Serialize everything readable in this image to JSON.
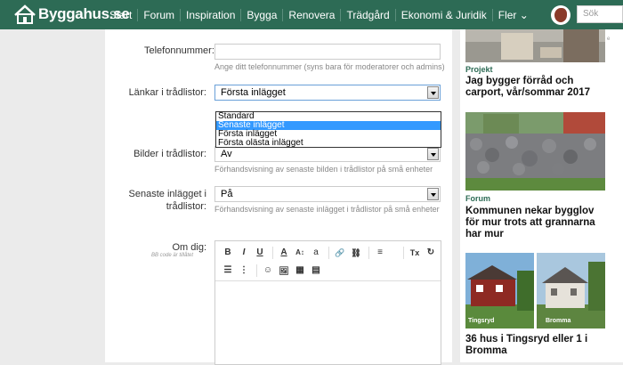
{
  "header": {
    "logo_text": "Byggahus.se",
    "nav": [
      "Start",
      "Forum",
      "Inspiration",
      "Bygga",
      "Renovera",
      "Trädgård",
      "Ekonomi & Juridik",
      "Fler ⌄"
    ],
    "search_placeholder": "Sök"
  },
  "form": {
    "phone_label": "Telefonnummer:",
    "phone_value": "",
    "phone_hint": "Ange ditt telefonnummer (syns bara för moderatorer och admins)",
    "links_label": "Länkar i trådlistor:",
    "links_value": "Första inlägget",
    "links_options": [
      "Standard",
      "Senaste inlägget",
      "Första inlägget",
      "Första olästa inlägget"
    ],
    "links_highlighted": "Senaste inlägget",
    "images_label": "Bilder i trådlistor:",
    "images_value": "Av",
    "images_hint": "Förhandsvisning av senaste bilden i trådlistor på små enheter",
    "latest_label_1": "Senaste inlägget i",
    "latest_label_2": "trådlistor:",
    "latest_value": "På",
    "latest_hint": "Förhandsvisning av senaste inlägget i trådlistor på små enheter",
    "about_label": "Om dig:",
    "about_hint": "BB code är tillåtet",
    "toolbar_row1": [
      "B",
      "I",
      "U",
      "A",
      "A↕",
      "a",
      "🔗",
      "⛓",
      "≡",
      "Tx",
      "↻"
    ],
    "toolbar_row2": [
      "☰",
      "⋮",
      "☺",
      "🖼",
      "▦",
      "▤"
    ]
  },
  "sidebar": {
    "cards": [
      {
        "category": "Projekt",
        "title": "Jag bygger förråd och carport, vår/sommar 2017"
      },
      {
        "category": "Forum",
        "title": "Kommunen nekar bygglov för mur trots att grannarna har mur"
      },
      {
        "category": "",
        "title": "36 hus i Tingsryd eller 1 i Bromma",
        "captions": [
          "Tingsryd",
          "Bromma"
        ]
      }
    ],
    "edge_text": "e"
  },
  "colors": {
    "brand": "#2d6b55",
    "highlight": "#3399ff"
  }
}
